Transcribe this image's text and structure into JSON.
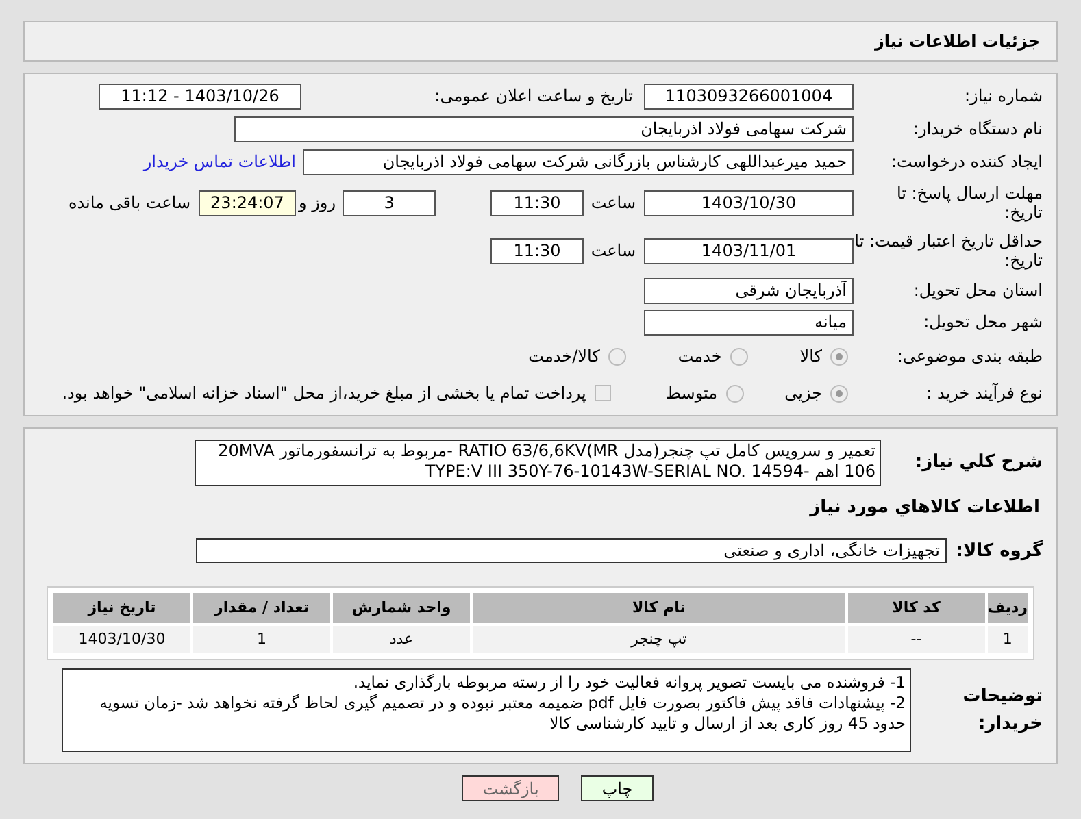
{
  "header": {
    "title": "جزئیات اطلاعات نیاز"
  },
  "need_number": {
    "label": "شماره نیاز:",
    "value": "1103093266001004"
  },
  "announce": {
    "label": "تاریخ و ساعت اعلان عمومی:",
    "value": "1403/10/26 - 11:12"
  },
  "buyer": {
    "label": "نام دستگاه خریدار:",
    "value": "شرکت سهامی فولاد اذربایجان"
  },
  "requester": {
    "label": "ایجاد کننده درخواست:",
    "value": "حمید میرعبداللهی کارشناس بازرگانی شرکت سهامی فولاد اذربایجان",
    "link": "اطلاعات تماس خریدار"
  },
  "deadline": {
    "label": "مهلت ارسال پاسخ: تا تاریخ:",
    "date": "1403/10/30",
    "time_label": "ساعت",
    "time": "11:30",
    "days": "3",
    "days_label": "روز و",
    "remaining": "23:24:07",
    "remaining_label": "ساعت باقی مانده"
  },
  "validity": {
    "label": "حداقل تاریخ اعتبار قیمت: تا تاریخ:",
    "date": "1403/11/01",
    "time_label": "ساعت",
    "time": "11:30"
  },
  "province": {
    "label": "استان محل تحویل:",
    "value": "آذربایجان شرقی"
  },
  "city": {
    "label": "شهر محل تحویل:",
    "value": "میانه"
  },
  "category": {
    "label": "طبقه بندی موضوعی:",
    "options": [
      {
        "label": "کالا",
        "selected": true
      },
      {
        "label": "خدمت",
        "selected": false
      },
      {
        "label": "کالا/خدمت",
        "selected": false
      }
    ]
  },
  "process": {
    "label": "نوع فرآیند خرید :",
    "options": [
      {
        "label": "جزیی",
        "selected": true
      },
      {
        "label": "متوسط",
        "selected": false
      }
    ],
    "treasury": {
      "label": "پرداخت تمام یا بخشی از مبلغ خرید،از محل \"اسناد خزانه اسلامی\" خواهد بود.",
      "checked": false
    }
  },
  "description": {
    "label": "شرح کلي نياز:",
    "lines": [
      "تعمیر و سرویس کامل تپ چنجر(مدل RATIO 63/6,6KV(MR -مربوط به ترانسفورماتور 20MVA",
      "106 اهم -TYPE:V III 350Y-76-10143W-SERIAL NO. 14594"
    ]
  },
  "goods_heading": "اطلاعات کالاهاي مورد نياز",
  "goods_group": {
    "label": "گروه کالا:",
    "value": "تجهیزات خانگی، اداری و صنعتی"
  },
  "table": {
    "columns": [
      "ردیف",
      "کد کالا",
      "نام کالا",
      "واحد شمارش",
      "تعداد / مقدار",
      "تاریخ نیاز"
    ],
    "rows": [
      [
        "1",
        "--",
        "تپ چنجر",
        "عدد",
        "1",
        "1403/10/30"
      ]
    ]
  },
  "notes": {
    "label": "توضیحات خریدار:",
    "lines": [
      "1- فروشنده می بایست تصویر پروانه فعالیت خود را از رسته مربوطه بارگذاری نماید.",
      "2- پیشنهادات فاقد پیش فاکتور بصورت فایل pdf  ضمیمه معتبر نبوده و در تصمیم گیری لحاظ گرفته نخواهد شد -زمان تسویه",
      "حدود 45  روز کاری بعد از ارسال و تایید کارشناسی کالا"
    ]
  },
  "buttons": [
    {
      "label": "چاپ",
      "kind": "print"
    },
    {
      "label": "بازگشت",
      "kind": "back"
    }
  ]
}
